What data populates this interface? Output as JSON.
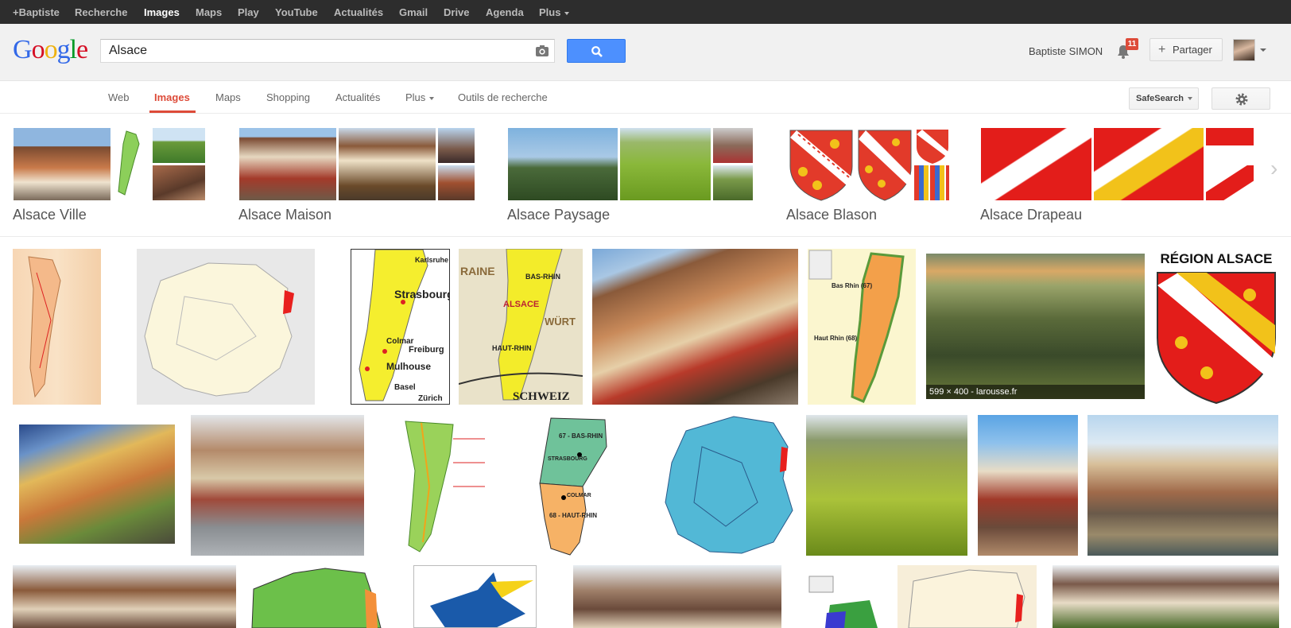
{
  "gbar": {
    "items": [
      "+Baptiste",
      "Recherche",
      "Images",
      "Maps",
      "Play",
      "YouTube",
      "Actualités",
      "Gmail",
      "Drive",
      "Agenda",
      "Plus"
    ]
  },
  "header": {
    "logo": [
      "G",
      "o",
      "o",
      "g",
      "l",
      "e"
    ],
    "query": "Alsace",
    "user_name": "Baptiste SIMON",
    "notification_count": "11",
    "share_label": "Partager"
  },
  "nav": {
    "tabs": [
      "Web",
      "Images",
      "Maps",
      "Shopping",
      "Actualités",
      "Plus",
      "Outils de recherche"
    ],
    "active_tab": "Images",
    "safesearch_label": "SafeSearch"
  },
  "related": [
    {
      "label": "Alsace Ville"
    },
    {
      "label": "Alsace Maison"
    },
    {
      "label": "Alsace Paysage"
    },
    {
      "label": "Alsace Blason"
    },
    {
      "label": "Alsace Drapeau"
    }
  ],
  "results": {
    "hover_label": "599 × 400 - larousse.fr",
    "region_title": "RÉGION ALSACE",
    "map_labels": [
      "Strasbourg",
      "Colmar",
      "Mulhouse",
      "Basel",
      "Zürich",
      "Karlsruhe",
      "Freiburg",
      "ALSACE",
      "BAS-RHIN",
      "HAUT-RHIN",
      "SCHWEIZ",
      "WÜRT",
      "RAINE",
      "Bas Rhin (67)",
      "Haut Rhin (68)",
      "67 - BAS-RHIN",
      "STRASBOURG",
      "COLMAR",
      "68 - HAUT-RHIN"
    ]
  }
}
